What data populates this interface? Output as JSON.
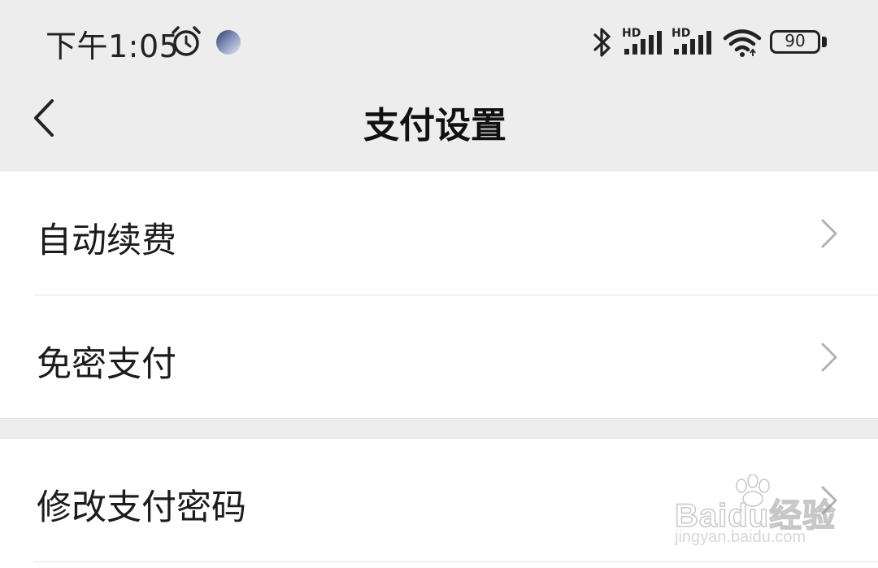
{
  "status_bar": {
    "time": "下午1:05",
    "network_1_tag": "HD",
    "network_2_tag": "HD",
    "battery_level": "90",
    "icons": [
      "alarm-icon",
      "app-notification-icon",
      "bluetooth-icon",
      "signal-icon",
      "signal-icon",
      "wifi-icon",
      "battery-icon"
    ]
  },
  "header": {
    "title": "支付设置",
    "back_icon": "chevron-left-icon"
  },
  "settings": {
    "group1": [
      {
        "label": "自动续费"
      },
      {
        "label": "免密支付"
      }
    ],
    "group2": [
      {
        "label": "修改支付密码"
      }
    ]
  },
  "watermark": {
    "brand": "Baidu经验",
    "url": "jingyan.baidu.com"
  },
  "colors": {
    "background": "#ededed",
    "card": "#ffffff",
    "text": "#1a1a1a",
    "chevron": "#b2b2b2"
  }
}
